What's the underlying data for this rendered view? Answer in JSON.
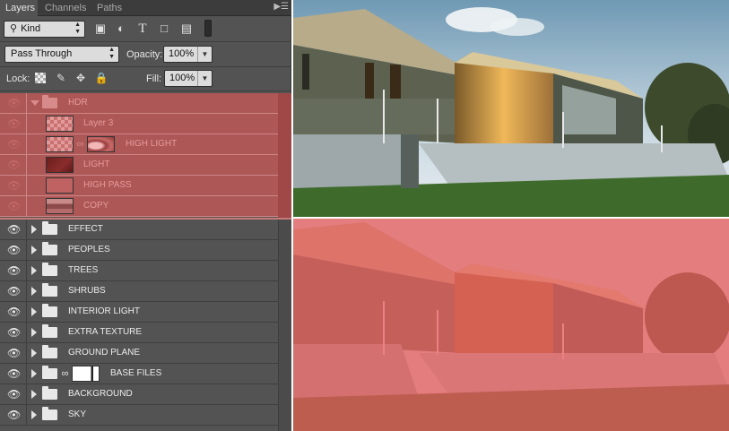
{
  "tabs": [
    {
      "label": "Layers",
      "active": true
    },
    {
      "label": "Channels",
      "active": false
    },
    {
      "label": "Paths",
      "active": false
    }
  ],
  "panel_menu_icon": "panel-menu-icon",
  "filter": {
    "kind_label": "Kind",
    "kind_icon": "search-icon",
    "filter_icons": [
      "image-filter-icon",
      "adjustment-filter-icon",
      "type-filter-icon",
      "shape-filter-icon",
      "smart-object-filter-icon"
    ]
  },
  "blend_mode": "Pass Through",
  "opacity_label": "Opacity:",
  "opacity_value": "100%",
  "lock_label": "Lock:",
  "lock_icons": [
    "lock-transparent-icon",
    "lock-image-icon",
    "lock-position-icon",
    "lock-all-icon"
  ],
  "fill_label": "Fill:",
  "fill_value": "100%",
  "layers": [
    {
      "name": "HDR",
      "type": "group",
      "expanded": true,
      "selected": true
    },
    {
      "name": "Layer 3",
      "type": "layer",
      "selected": true,
      "thumb": "transparent"
    },
    {
      "name": "HIGH LIGHT",
      "type": "layer",
      "selected": true,
      "thumb": "transparent",
      "mask": true
    },
    {
      "name": "LIGHT",
      "type": "layer",
      "selected": true,
      "thumb": "dark-red"
    },
    {
      "name": "HIGH PASS",
      "type": "layer",
      "selected": true,
      "thumb": "flat-red"
    },
    {
      "name": "COPY",
      "type": "layer",
      "selected": true,
      "thumb": "photo"
    },
    {
      "name": "EFFECT",
      "type": "group"
    },
    {
      "name": "PEOPLES",
      "type": "group"
    },
    {
      "name": "TREES",
      "type": "group"
    },
    {
      "name": "SHRUBS",
      "type": "group"
    },
    {
      "name": "INTERIOR LIGHT",
      "type": "group"
    },
    {
      "name": "EXTRA TEXTURE",
      "type": "group"
    },
    {
      "name": "GROUND PLANE",
      "type": "group"
    },
    {
      "name": "BASE FILES",
      "type": "group",
      "mask": true
    },
    {
      "name": "BACKGROUND",
      "type": "group"
    },
    {
      "name": "SKY",
      "type": "group"
    }
  ],
  "colors": {
    "panel_bg": "#535353",
    "selection": "#ad5757",
    "tint": "#e85858"
  }
}
